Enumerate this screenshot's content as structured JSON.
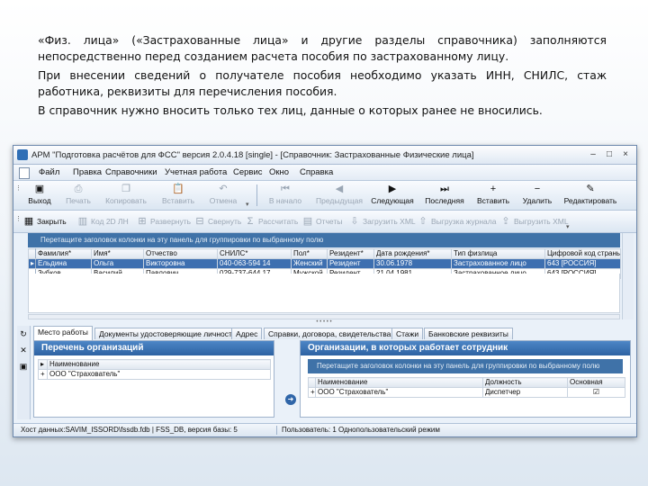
{
  "slide": {
    "para1": "«Физ. лица» («Застрахованные лица» и другие разделы справочника) заполняются непосредственно перед созданием расчета пособия по застрахованному лицу.",
    "para2": "При внесении сведений о получателе пособия необходимо указать ИНН, СНИЛС, стаж работника, реквизиты для перечисления пособия.",
    "para3": "В справочник нужно вносить только тех лиц, данные о которых ранее не вносились."
  },
  "window": {
    "title": "АРМ \"Подготовка расчётов для ФСС\" версия 2.0.4.18 [single] - [Справочник: Застрахованные Физические лица]",
    "controls": {
      "minimize": "–",
      "maximize": "□",
      "close": "×"
    }
  },
  "menu": [
    "Файл",
    "Правка",
    "Справочники",
    "Учетная работа",
    "Сервис",
    "Окно",
    "Справка"
  ],
  "toolbar1": [
    {
      "label": "Выход",
      "icon": "exit-icon",
      "glyph": "▣",
      "enabled": true
    },
    {
      "label": "Печать",
      "icon": "print-icon",
      "glyph": "⎙",
      "enabled": false
    },
    {
      "label": "Копировать",
      "icon": "copy-icon",
      "glyph": "❐",
      "enabled": false
    },
    {
      "label": "Вставить",
      "icon": "paste-icon",
      "glyph": "📋",
      "enabled": false
    },
    {
      "label": "Отмена",
      "icon": "undo-icon",
      "glyph": "↶",
      "enabled": false
    },
    {
      "label": "В начало",
      "icon": "first-record-icon",
      "glyph": "⏮",
      "enabled": false
    },
    {
      "label": "Предыдущая",
      "icon": "prev-record-icon",
      "glyph": "◀",
      "enabled": false
    },
    {
      "label": "Следующая",
      "icon": "next-record-icon",
      "glyph": "▶",
      "enabled": true
    },
    {
      "label": "Последняя",
      "icon": "last-record-icon",
      "glyph": "⏭",
      "enabled": true
    },
    {
      "label": "Вставить",
      "icon": "insert-record-icon",
      "glyph": "+",
      "enabled": true
    },
    {
      "label": "Удалить",
      "icon": "delete-record-icon",
      "glyph": "−",
      "enabled": true
    },
    {
      "label": "Редактировать",
      "icon": "edit-record-icon",
      "glyph": "✎",
      "enabled": true
    }
  ],
  "toolbar2": [
    {
      "label": "Закрыть",
      "icon": "close-doc-icon",
      "glyph": "▦",
      "enabled": true
    },
    {
      "label": "Код 2D ЛН",
      "icon": "barcode-icon",
      "glyph": "▥",
      "enabled": false
    },
    {
      "label": "Развернуть",
      "icon": "expand-icon",
      "glyph": "⊞",
      "enabled": false
    },
    {
      "label": "Свернуть",
      "icon": "collapse-icon",
      "glyph": "⊟",
      "enabled": false
    },
    {
      "label": "Рассчитать",
      "icon": "calculate-icon",
      "glyph": "Σ",
      "enabled": false
    },
    {
      "label": "Отчеты",
      "icon": "reports-icon",
      "glyph": "▤",
      "enabled": false
    },
    {
      "label": "Загрузить XML",
      "icon": "load-xml-icon",
      "glyph": "⇩",
      "enabled": false
    },
    {
      "label": "Выгрузка журнала",
      "icon": "export-log-icon",
      "glyph": "⇧",
      "enabled": false
    },
    {
      "label": "Выгрузить XML",
      "icon": "export-xml-icon",
      "glyph": "⇪",
      "enabled": false
    }
  ],
  "grid": {
    "group_hint": "Перетащите заголовок колонки на эту панель для группировки по выбранному полю",
    "columns": [
      "Фамилия*",
      "Имя*",
      "Отчество",
      "СНИЛС*",
      "Пол*",
      "Резидент*",
      "Дата рождения*",
      "Тип физлица",
      "Цифровой код страны"
    ],
    "rows": [
      [
        "Ельдина",
        "Ольга",
        "Викторовна",
        "040-063-594 14",
        "Женский",
        "Резидент",
        "30.06.1978",
        "Застрахованное лицо",
        "643 [РОССИЯ]"
      ],
      [
        "Зубков",
        "Василий",
        "Павлович",
        "029-737-644 17",
        "Мужской",
        "Резидент",
        "21.04.1981",
        "Застрахованное лицо",
        "643 [РОССИЯ]"
      ]
    ],
    "selected_row": 0
  },
  "tabs": [
    "Место работы",
    "Документы удостоверяющие личность",
    "Адрес",
    "Справки, договора, свидетельства",
    "Стажи",
    "Банковские реквизиты"
  ],
  "left_panel": {
    "title": "Перечень организаций",
    "column": "Наименование",
    "rows": [
      "ООО \"Страхователь\""
    ]
  },
  "right_panel": {
    "title": "Организации, в которых работает сотрудник",
    "group_hint": "Перетащите заголовок колонки на эту панель для группировки по выбранному полю",
    "columns": [
      "Наименование",
      "Должность",
      "Основная"
    ],
    "rows": [
      {
        "name": "ООО \"Страхователь\"",
        "position": "Диспетчер",
        "main": "☑"
      }
    ]
  },
  "status": {
    "left": "Хост данных:SAVIM_ISSORD\\fssdb.fdb | FSS_DB, версия базы: 5",
    "user": "Пользователь: 1 Однопользовательский режим"
  },
  "colors": {
    "accent": "#3d6fb0",
    "panel_header": "#2e63a3",
    "hint_bar": "#3f72a8"
  }
}
